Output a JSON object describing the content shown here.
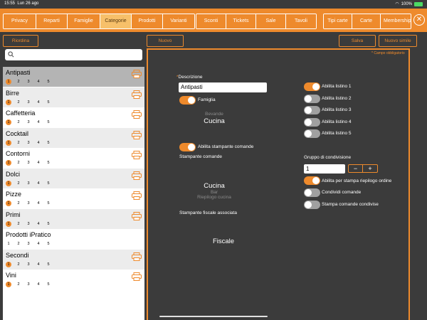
{
  "status": {
    "time": "15:55",
    "date": "Lun 26 ago",
    "battery": "100%"
  },
  "nav": {
    "groups": [
      [
        "Privacy",
        "Reparti",
        "Famiglie",
        "Categorie",
        "Prodotti",
        "Varianti"
      ],
      [
        "Sconti",
        "Tickets",
        "Sale",
        "Tavoli"
      ],
      [
        "Tipi carte",
        "Carte",
        "Membership"
      ]
    ],
    "active": "Categorie",
    "close_label": "✕"
  },
  "toolbar": {
    "reorder": "Riordina",
    "new": "Nuovo",
    "save": "Salva",
    "new_similar": "Nuovo simile"
  },
  "search": {
    "placeholder": ""
  },
  "categories": [
    {
      "name": "Antipasti",
      "active": [
        1
      ],
      "selected": true
    },
    {
      "name": "Birre",
      "active": [
        1
      ]
    },
    {
      "name": "Caffetteria",
      "active": [
        1
      ]
    },
    {
      "name": "Cocktail",
      "active": [
        1
      ]
    },
    {
      "name": "Contorni",
      "active": [
        1
      ]
    },
    {
      "name": "Dolci",
      "active": [
        1
      ]
    },
    {
      "name": "Pizze",
      "active": [
        1
      ]
    },
    {
      "name": "Primi",
      "active": [
        1
      ]
    },
    {
      "name": "Prodotti iPratico",
      "active": []
    },
    {
      "name": "Secondi",
      "active": [
        1
      ]
    },
    {
      "name": "Vini",
      "active": [
        1
      ]
    }
  ],
  "list_numbers": [
    "1",
    "2",
    "3",
    "4",
    "5"
  ],
  "form": {
    "required_note": "* Campo obbligatorio",
    "description_label": "Descrizione",
    "description_value": "Antipasti",
    "family_label": "Famiglia",
    "family_picker": {
      "prev": "Bevande",
      "selected": "Cucina"
    },
    "enable_printer_label": "Abilita stampante comande",
    "printer_label": "Stampante comande",
    "printer_picker": {
      "selected": "Cucina",
      "next1": "Bar",
      "next2": "Riepilogo cucina"
    },
    "fiscal_label": "Stampante fiscale associata",
    "fiscal_picker": {
      "selected": "Fiscale"
    },
    "listini": [
      {
        "label": "Abilita listino 1",
        "on": true
      },
      {
        "label": "Abilita listino 2",
        "on": false
      },
      {
        "label": "Abilita listino 3",
        "on": false
      },
      {
        "label": "Abilita listino 4",
        "on": false
      },
      {
        "label": "Abilita listino 5",
        "on": false
      }
    ],
    "group_label": "Gruppo di condivisione",
    "group_value": "1",
    "stepper": {
      "minus": "−",
      "plus": "+"
    },
    "options": [
      {
        "label": "Abilita per stampa riepilogo ordine",
        "on": true
      },
      {
        "label": "Condividi comande",
        "on": false
      },
      {
        "label": "Stampa comande condivise",
        "on": false
      }
    ]
  },
  "colors": {
    "accent": "#ee8a2c",
    "background": "#3b3b3b",
    "selected_row": "#b4b4b4"
  }
}
